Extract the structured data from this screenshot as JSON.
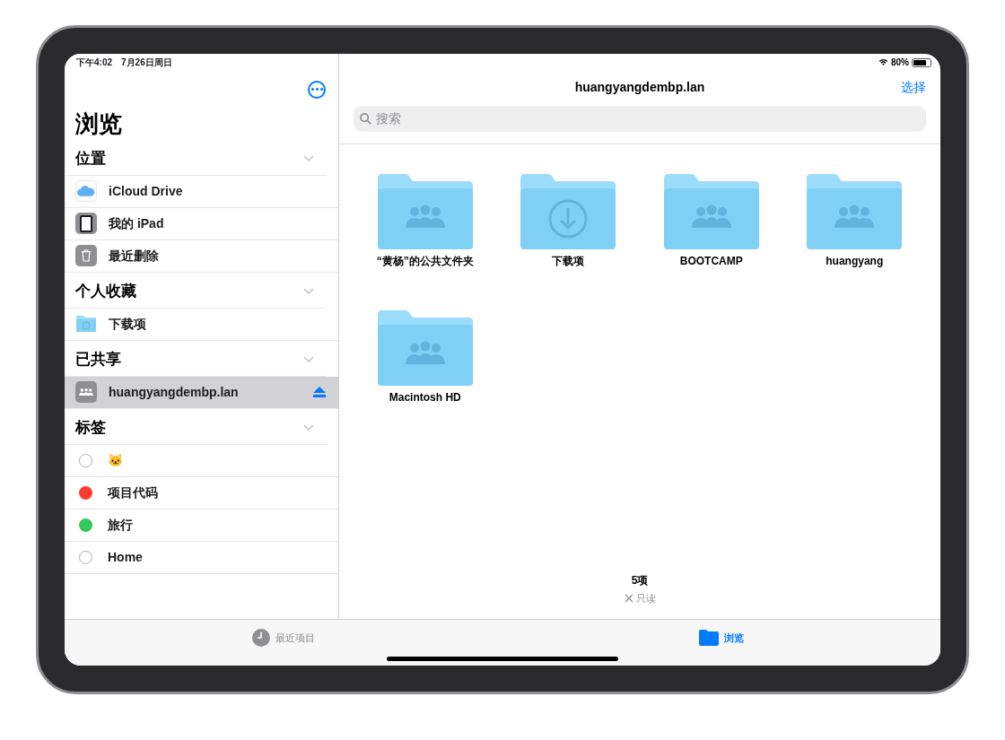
{
  "status_bar": {
    "time": "下午4:02",
    "date": "7月26日周日",
    "battery": "80%"
  },
  "sidebar": {
    "title": "浏览",
    "sections": [
      {
        "title": "位置",
        "expanded": true,
        "items": [
          {
            "label": "iCloud Drive",
            "kind": "icloud",
            "selected": false
          },
          {
            "label": "我的 iPad",
            "kind": "ipad",
            "selected": false
          },
          {
            "label": "最近删除",
            "kind": "trash",
            "selected": false
          }
        ]
      },
      {
        "title": "个人收藏",
        "expanded": true,
        "items": [
          {
            "label": "下载项",
            "kind": "folder",
            "selected": false
          }
        ]
      },
      {
        "title": "已共享",
        "expanded": true,
        "items": [
          {
            "label": "huangyangdembp.lan",
            "kind": "server",
            "selected": true
          }
        ]
      },
      {
        "title": "标签",
        "expanded": true,
        "items": [
          {
            "label": "🐱",
            "kind": "tag",
            "selected": false
          },
          {
            "label": "项目代码",
            "kind": "tag",
            "selected": false,
            "color": "#ff3b30"
          },
          {
            "label": "旅行",
            "kind": "tag",
            "selected": false,
            "color": "#34c759"
          },
          {
            "label": "Home",
            "kind": "tag",
            "selected": false
          }
        ]
      }
    ]
  },
  "main": {
    "title": "huangyangdembp.lan",
    "select_button": "选择",
    "search": {
      "placeholder": "搜索"
    },
    "folders": [
      {
        "name": "“黄杨”的公共文件夹",
        "kind": "shared"
      },
      {
        "name": "下载项",
        "kind": "downloads"
      },
      {
        "name": "BOOTCAMP",
        "kind": "shared"
      },
      {
        "name": "huangyang",
        "kind": "shared"
      },
      {
        "name": "Macintosh HD",
        "kind": "shared"
      }
    ],
    "footer": {
      "count": "5项",
      "readonly": "只读"
    }
  },
  "tab_bar": [
    {
      "label": "最近项目",
      "kind": "recents",
      "selected": false
    },
    {
      "label": "浏览",
      "kind": "browse",
      "selected": true
    }
  ]
}
